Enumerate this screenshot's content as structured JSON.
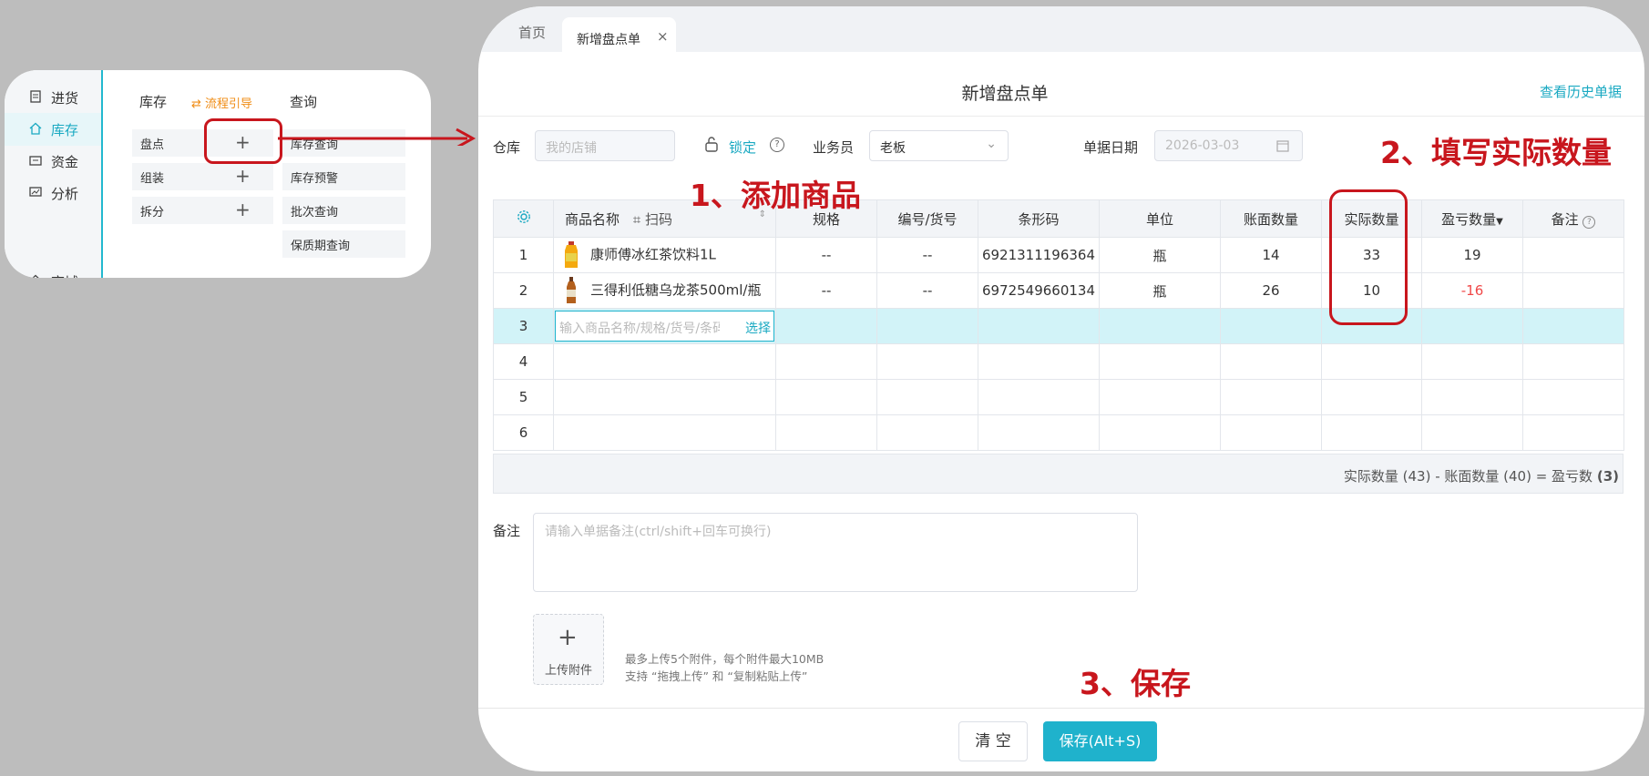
{
  "menu": {
    "side_items": [
      {
        "label": "进货",
        "icon": "receipt-icon"
      },
      {
        "label": "库存",
        "icon": "home-icon",
        "active": true
      },
      {
        "label": "资金",
        "icon": "wallet-icon"
      },
      {
        "label": "分析",
        "icon": "chart-icon"
      },
      {
        "label": "商城",
        "icon": "shop-icon"
      }
    ],
    "col_inventory": "库存",
    "flow_guide": "流程引导",
    "col_query": "查询",
    "inventory_items": [
      "盘点",
      "组装",
      "拆分"
    ],
    "query_items": [
      "库存查询",
      "库存预警",
      "批次查询",
      "保质期查询"
    ],
    "plus_glyph": "+"
  },
  "tabs": {
    "home": "首页",
    "active": "新增盘点单",
    "close_glyph": "×"
  },
  "page": {
    "title": "新增盘点单",
    "history_link": "查看历史单据"
  },
  "form": {
    "warehouse_label": "仓库",
    "warehouse_placeholder": "我的店铺",
    "lock_label": "锁定",
    "help_glyph": "?",
    "salesman_label": "业务员",
    "salesman_value": "老板",
    "date_label": "单据日期",
    "date_value": "2026-03-03"
  },
  "table": {
    "headers": {
      "name": "商品名称",
      "scan": "扫码",
      "spec": "规格",
      "code": "编号/货号",
      "barcode": "条形码",
      "unit": "单位",
      "book_qty": "账面数量",
      "actual_qty": "实际数量",
      "diff_qty": "盈亏数量",
      "remark": "备注"
    },
    "rows": [
      {
        "no": "1",
        "name": "康师傅冰红茶饮料1L",
        "spec": "--",
        "code": "--",
        "barcode": "6921311196364",
        "unit": "瓶",
        "book_qty": "14",
        "actual_qty": "33",
        "diff_qty": "19",
        "remark": ""
      },
      {
        "no": "2",
        "name": "三得利低糖乌龙茶500ml/瓶",
        "spec": "--",
        "code": "--",
        "barcode": "6972549660134",
        "unit": "瓶",
        "book_qty": "26",
        "actual_qty": "10",
        "diff_qty": "-16",
        "remark": ""
      }
    ],
    "input_row_no": "3",
    "input_placeholder": "输入商品名称/规格/货号/条码",
    "select_label": "选择",
    "empty_rows": [
      "4",
      "5",
      "6"
    ],
    "summary": "实际数量 (43) - 账面数量 (40) = 盈亏数",
    "summary_value": "(3)"
  },
  "remark": {
    "label": "备注",
    "placeholder": "请输入单据备注(ctrl/shift+回车可换行)"
  },
  "upload": {
    "plus_glyph": "+",
    "label": "上传附件",
    "hint1": "最多上传5个附件，每个附件最大10MB",
    "hint2": "支持 “拖拽上传” 和 “复制粘贴上传”"
  },
  "buttons": {
    "clear": "清 空",
    "save": "保存(Alt+S)"
  },
  "annotations": {
    "step1": "1、添加商品",
    "step2": "2、填写实际数量",
    "step3": "3、保存"
  },
  "colors": {
    "accent": "#1fb2cc",
    "annotation_red": "#c8161d",
    "negative": "#f04848",
    "flow_orange": "#f08c14"
  }
}
